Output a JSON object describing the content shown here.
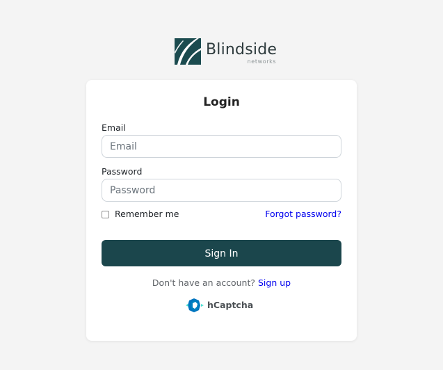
{
  "brand": {
    "name": "Blindside",
    "tagline": "networks",
    "logo_icon": "blindside-logo-icon",
    "color": "#1b4b4f"
  },
  "login": {
    "title": "Login",
    "email_label": "Email",
    "email_placeholder": "Email",
    "email_value": "",
    "password_label": "Password",
    "password_placeholder": "Password",
    "password_value": "",
    "remember_label": "Remember me",
    "remember_checked": false,
    "forgot_link": "Forgot password?",
    "submit_label": "Sign In",
    "submit_color": "#1b464c",
    "signup_prompt": "Don't have an account?",
    "signup_link": "Sign up"
  },
  "captcha": {
    "label": "hCaptcha",
    "icon": "hcaptcha-icon",
    "accent": "#0074bf"
  }
}
